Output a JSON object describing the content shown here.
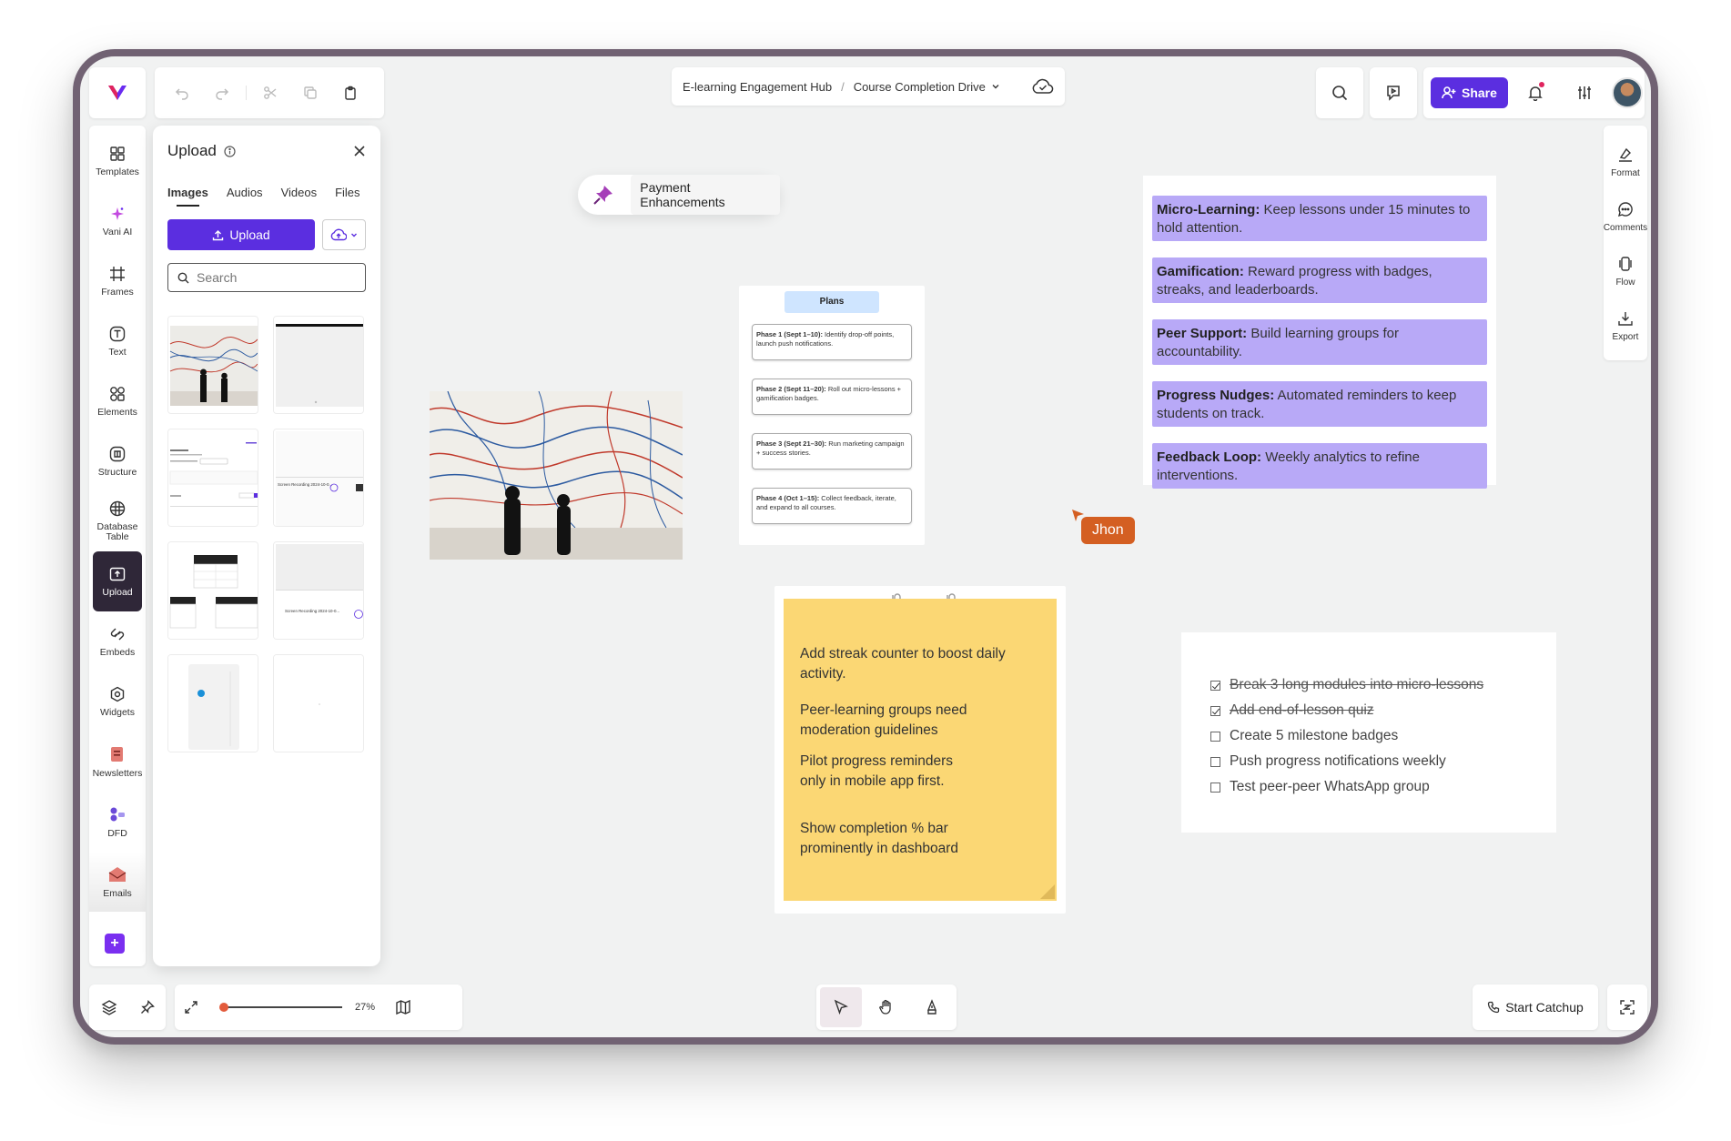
{
  "breadcrumb": {
    "workspace": "E-learning Engagement Hub",
    "separator": "/",
    "board": "Course Completion Drive"
  },
  "topbar": {
    "share_label": "Share"
  },
  "left_rail": {
    "items": [
      {
        "label": "Templates",
        "icon": "templates-icon"
      },
      {
        "label": "Vani AI",
        "icon": "sparkle-icon"
      },
      {
        "label": "Frames",
        "icon": "frame-icon"
      },
      {
        "label": "Text",
        "icon": "text-icon"
      },
      {
        "label": "Elements",
        "icon": "elements-icon"
      },
      {
        "label": "Structure",
        "icon": "structure-icon"
      },
      {
        "label": "Database Table",
        "icon": "database-icon"
      },
      {
        "label": "Upload",
        "icon": "upload-icon",
        "active": true
      },
      {
        "label": "Embeds",
        "icon": "embed-icon"
      },
      {
        "label": "Widgets",
        "icon": "widget-icon"
      },
      {
        "label": "Newsletters",
        "icon": "newsletter-icon"
      },
      {
        "label": "DFD",
        "icon": "dfd-icon"
      },
      {
        "label": "Emails",
        "icon": "email-icon"
      }
    ]
  },
  "upload_panel": {
    "title": "Upload",
    "tabs": [
      "Images",
      "Audios",
      "Videos",
      "Files"
    ],
    "active_tab": "Images",
    "upload_label": "Upload",
    "search_placeholder": "Search",
    "thumb_texts": {
      "recording_1": "Screen Recording 2024-10-0...",
      "recording_2": "Screen Recording 2024-10-0..."
    }
  },
  "canvas": {
    "pinned_label": "Payment Enhancements",
    "plans": {
      "title": "Plans",
      "phases": [
        {
          "head": "Phase 1 (Sept 1–10):",
          "body": "Identify drop-off points, launch push notifications."
        },
        {
          "head": "Phase 2 (Sept 11–20):",
          "body": "Roll out micro-lessons + gamification badges."
        },
        {
          "head": "Phase 3 (Sept 21–30):",
          "body": "Run marketing campaign + success stories."
        },
        {
          "head": "Phase 4 (Oct 1–15):",
          "body": "Collect feedback, iterate, and expand to all courses."
        }
      ]
    },
    "tips": [
      {
        "head": "Micro-Learning:",
        "body": "Keep lessons under 15 minutes to hold attention."
      },
      {
        "head": "Gamification:",
        "body": "Reward progress with badges, streaks, and leaderboards."
      },
      {
        "head": "Peer Support:",
        "body": "Build learning groups for accountability."
      },
      {
        "head": "Progress Nudges:",
        "body": "Automated reminders to keep students on track."
      },
      {
        "head": "Feedback Loop:",
        "body": "Weekly analytics to refine interventions."
      }
    ],
    "cursor_user": "Jhon",
    "sticky_notes": [
      "Add streak counter to boost daily activity.",
      "Peer-learning groups need moderation guidelines",
      "Pilot progress reminders only in mobile app first.",
      "Show completion % bar prominently in dashboard"
    ],
    "checklist": [
      {
        "text": "Break 3 long modules into micro-lessons",
        "done": true
      },
      {
        "text": "Add end-of-lesson quiz",
        "done": true
      },
      {
        "text": "Create 5 milestone badges",
        "done": false
      },
      {
        "text": "Push progress notifications weekly",
        "done": false
      },
      {
        "text": "Test peer-peer WhatsApp group",
        "done": false
      }
    ]
  },
  "right_rail": {
    "items": [
      "Format",
      "Comments",
      "Flow",
      "Export"
    ]
  },
  "bottom": {
    "zoom": "27%",
    "zoom_level": 0.0,
    "catchup_label": "Start Catchup"
  },
  "colors": {
    "accent": "#5b2ee0",
    "tips_bg": "#b8a9f7",
    "sticky_bg": "#fbd774",
    "cursor": "#d45f22",
    "frame": "#716273"
  }
}
